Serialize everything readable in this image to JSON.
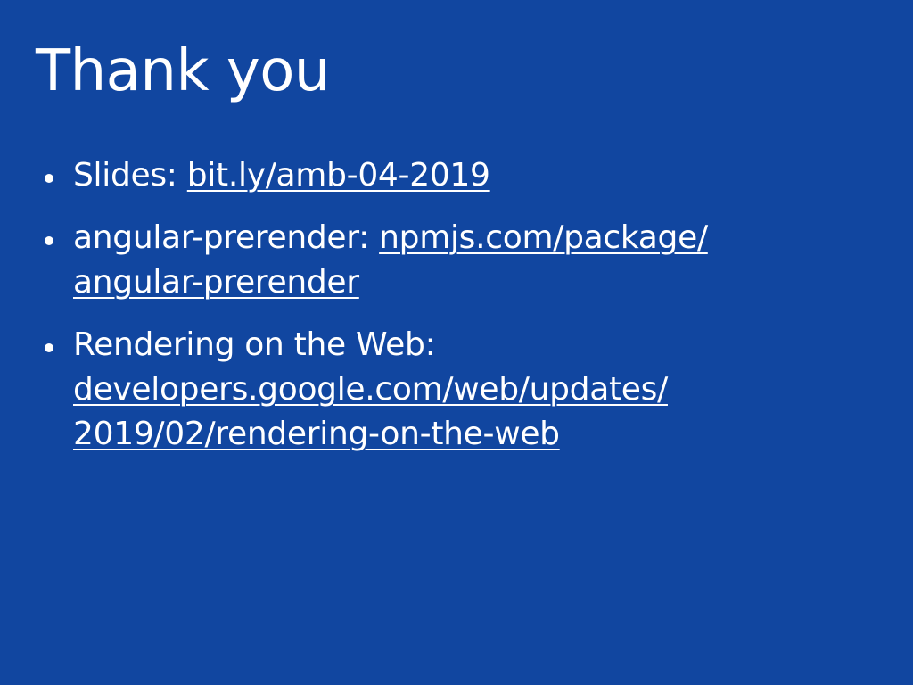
{
  "slide": {
    "title": "Thank you",
    "bullets": [
      {
        "label": "Slides: ",
        "link_lines": [
          "bit.ly/amb-04-2019"
        ]
      },
      {
        "label": "angular-prerender: ",
        "link_lines": [
          "npmjs.com/package/",
          "angular-prerender"
        ]
      },
      {
        "label": "Rendering on the Web:",
        "link_lines": [
          "developers.google.com/web/updates/",
          "2019/02/rendering-on-the-web"
        ]
      }
    ]
  },
  "colors": {
    "background": "#1146a0",
    "text": "#ffffff"
  }
}
